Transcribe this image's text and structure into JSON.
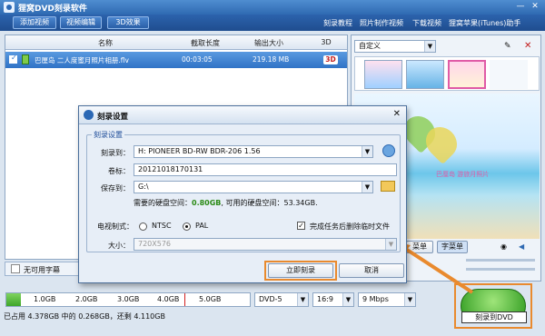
{
  "app": {
    "title": "狸窝DVD刻录软件",
    "minimize": "—",
    "close": "✕"
  },
  "toolbar": {
    "buttons": [
      "添加视频",
      "视频编辑",
      "3D效果"
    ],
    "links": [
      "刻录教程",
      "照片制作视频",
      "下载视频",
      "狸窝苹果(iTunes)助手"
    ]
  },
  "list": {
    "columns": [
      "名称",
      "截取长度",
      "输出大小",
      "3D"
    ],
    "rows": [
      {
        "name": "巴厘岛 二人度蜜月照片相册.flv",
        "length": "00:03:05",
        "size": "219.18 MB",
        "badge": "3D"
      }
    ]
  },
  "subtitle": {
    "value": "无可用字幕"
  },
  "right_panel": {
    "template": "自定义",
    "btn_a": "菜单",
    "btn_b": "字菜单",
    "caption": "巴厘岛 游旅月照片"
  },
  "capacity": {
    "ticks": [
      "1.0GB",
      "2.0GB",
      "3.0GB",
      "4.0GB",
      "5.0GB"
    ],
    "status": "已占用 4.378GB 中的 0.268GB，还剩 4.110GB",
    "fill_fraction": 0.06
  },
  "options": {
    "disc": "DVD-5",
    "aspect": "16:9",
    "bitrate": "9 Mbps"
  },
  "burn_button": {
    "label": "刻录到DVD"
  },
  "dialog": {
    "title": "刻录设置",
    "group_title": "刻录设置",
    "burn_to_label": "刻录到：",
    "burn_to_value": "H: PIONEER BD-RW   BDR-206 1.56",
    "volume_label": "卷标：",
    "volume_value": "20121018170131",
    "save_to_label": "保存到：",
    "save_to_value": "G:\\",
    "space_prefix": "需要的硬盘空间：",
    "space_required": "0.80GB",
    "space_suffix": ", 可用的硬盘空间：53.34GB.",
    "tv_label": "电视制式：",
    "ntsc": "NTSC",
    "pal": "PAL",
    "delete_temp_label": "完成任务后删除临时文件",
    "size_label": "大小：",
    "size_value": "720X576",
    "burn_now": "立即刻录",
    "cancel": "取消",
    "close": "✕"
  },
  "colors": {
    "accent": "#2f6ab2",
    "highlight": "#e98a2e",
    "ok_green": "#2a8a15"
  }
}
